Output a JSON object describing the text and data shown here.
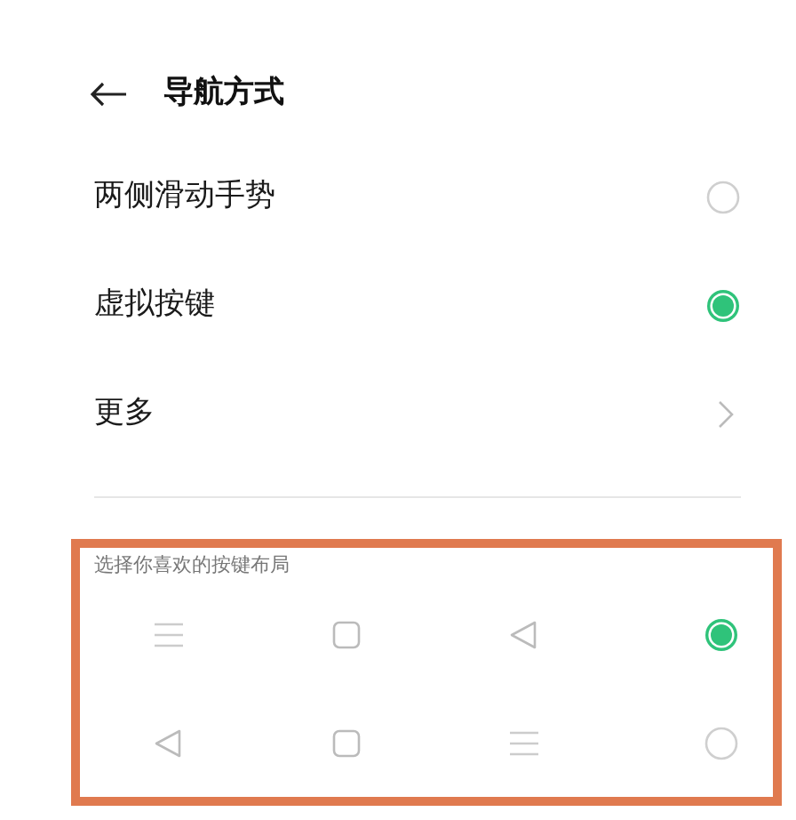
{
  "header": {
    "title": "导航方式"
  },
  "options": [
    {
      "kind": "radio",
      "label": "两侧滑动手势",
      "selected": false
    },
    {
      "kind": "radio",
      "label": "虚拟按键",
      "selected": true
    },
    {
      "kind": "link",
      "label": "更多"
    }
  ],
  "layout_picker": {
    "label": "选择你喜欢的按键布局",
    "layouts": [
      {
        "keys": [
          {
            "kind": "menu"
          },
          {
            "kind": "home"
          },
          {
            "kind": "back"
          }
        ],
        "selected": true
      },
      {
        "keys": [
          {
            "kind": "back"
          },
          {
            "kind": "home"
          },
          {
            "kind": "menu"
          }
        ],
        "selected": false
      }
    ]
  }
}
